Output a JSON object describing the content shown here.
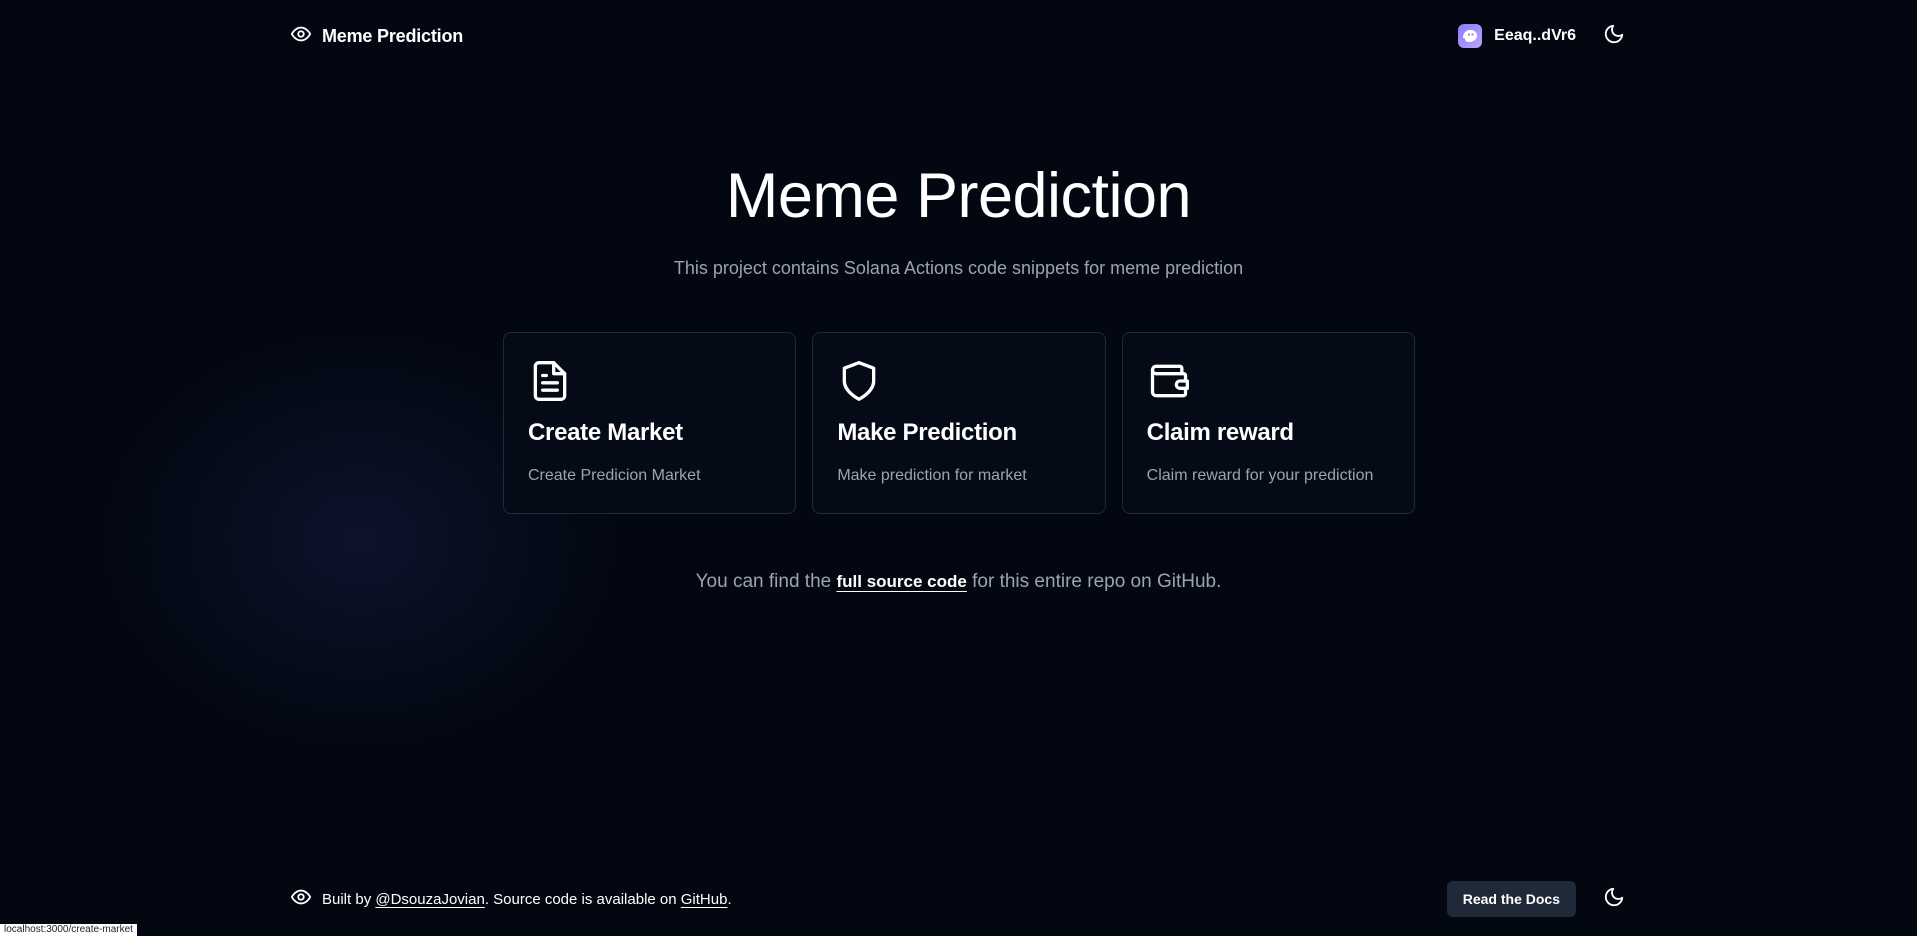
{
  "header": {
    "brand_title": "Meme Prediction",
    "wallet_label": "Eeaq..dVr6"
  },
  "hero": {
    "title": "Meme Prediction",
    "subtitle": "This project contains Solana Actions code snippets for meme prediction"
  },
  "cards": [
    {
      "icon": "document-icon",
      "title": "Create Market",
      "description": "Create Predicion Market"
    },
    {
      "icon": "shield-icon",
      "title": "Make Prediction",
      "description": "Make prediction for market"
    },
    {
      "icon": "wallet-icon",
      "title": "Claim reward",
      "description": "Claim reward for your prediction"
    }
  ],
  "source": {
    "prefix": "You can find the ",
    "link": "full source code",
    "suffix": " for this entire repo on GitHub."
  },
  "footer": {
    "built_by": "Built by ",
    "author": "@DsouzaJovian",
    "middle": ". Source code is available on ",
    "github": "GitHub",
    "end": ".",
    "docs_button": "Read the Docs"
  },
  "statusbar": {
    "url": "localhost:3000/create-market"
  },
  "colors": {
    "background": "#030712",
    "muted_text": "#9ca3af",
    "card_border": "#1f2937",
    "button_bg": "#1f2937",
    "avatar_accent": "#8b7cf6"
  }
}
